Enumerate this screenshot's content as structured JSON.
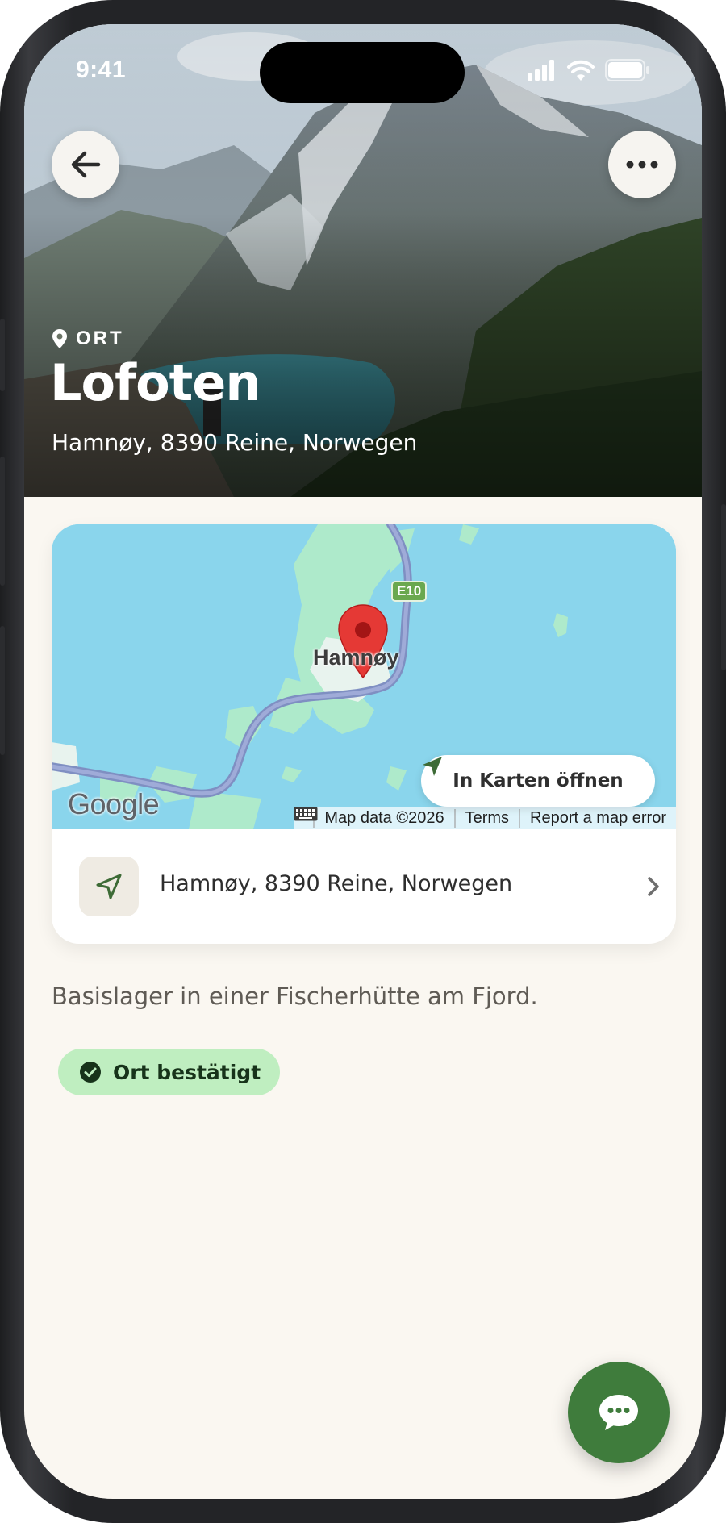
{
  "status_bar": {
    "time": "9:41",
    "icons": [
      "cellular-signal-icon",
      "wifi-icon",
      "battery-icon"
    ]
  },
  "hero": {
    "back_icon": "arrow-left-icon",
    "more_icon": "ellipsis-icon",
    "kind_icon": "location-pin-icon",
    "kind_label": "ORT",
    "title": "Lofoten",
    "address": "Hamnøy, 8390 Reine, Norwegen"
  },
  "map": {
    "town_label": "Hamnøy",
    "road_shield": "E10",
    "google_logo": "Google",
    "attribution": {
      "keyboard_icon": "keyboard-icon",
      "map_data": "Map data ©2026",
      "terms": "Terms",
      "report": "Report a map error"
    },
    "open_button": {
      "icon": "navigation-arrow-icon",
      "label": "In Karten öffnen"
    },
    "marker_icon": "map-pin-icon"
  },
  "address_row": {
    "icon": "navigation-arrow-icon",
    "text": "Hamnøy, 8390 Reine, Norwegen",
    "chevron_icon": "chevron-right-icon"
  },
  "description": "Basislager in einer Fischerhütte am Fjord.",
  "status_badge": {
    "icon": "check-circle-icon",
    "label": "Ort bestätigt",
    "color": "#bfeec0"
  },
  "fab": {
    "icon": "chat-bubble-icon",
    "color": "#3f7c3c"
  },
  "colors": {
    "background": "#faf7f1",
    "accent": "#3f7c3c",
    "water": "#8ad5ec"
  }
}
